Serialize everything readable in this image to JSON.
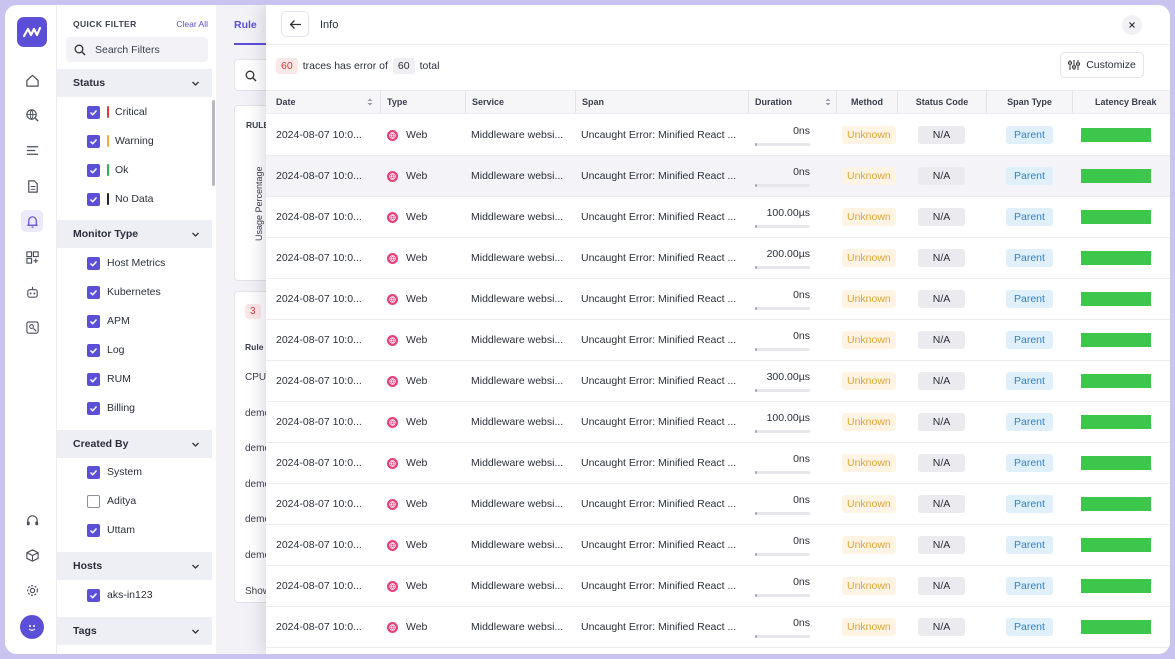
{
  "filter": {
    "title": "QUICK FILTER",
    "clear_label": "Clear All",
    "search_placeholder": "Search Filters",
    "sections": {
      "status": {
        "title": "Status",
        "items": [
          {
            "label": "Critical",
            "checked": true,
            "color": "#e23b3b"
          },
          {
            "label": "Warning",
            "checked": true,
            "color": "#f0a93a"
          },
          {
            "label": "Ok",
            "checked": true,
            "color": "#2fb24c"
          },
          {
            "label": "No Data",
            "checked": true,
            "color": "#1f2430"
          }
        ]
      },
      "monitor_type": {
        "title": "Monitor Type",
        "items": [
          {
            "label": "Host Metrics",
            "checked": true
          },
          {
            "label": "Kubernetes",
            "checked": true
          },
          {
            "label": "APM",
            "checked": true
          },
          {
            "label": "Log",
            "checked": true
          },
          {
            "label": "RUM",
            "checked": true
          },
          {
            "label": "Billing",
            "checked": true
          }
        ]
      },
      "created_by": {
        "title": "Created By",
        "items": [
          {
            "label": "System",
            "checked": true
          },
          {
            "label": "Aditya",
            "checked": false
          },
          {
            "label": "Uttam",
            "checked": true
          }
        ]
      },
      "hosts": {
        "title": "Hosts",
        "items": [
          {
            "label": "aks-in123",
            "checked": true
          }
        ]
      },
      "tags": {
        "title": "Tags"
      }
    }
  },
  "background": {
    "tab": "Rule",
    "card1_label": "RULE",
    "axis_label": "Usage Percentage",
    "count": "3",
    "col": "Rule N",
    "rows": [
      "CPU",
      "demo",
      "demo",
      "demo",
      "demo",
      "demo"
    ],
    "show": "Show"
  },
  "modal": {
    "title": "Info",
    "summary": {
      "errors": "60",
      "middle": "traces has error of",
      "total": "60",
      "suffix": "total"
    },
    "customize_label": "Customize",
    "columns": [
      "Date",
      "Type",
      "Service",
      "Span",
      "Duration",
      "Method",
      "Status Code",
      "Span Type",
      "Latency Break"
    ],
    "rows": [
      {
        "date": "2024-08-07 10:0...",
        "type": "Web",
        "service": "Middleware websi...",
        "span": "Uncaught Error: Minified React ...",
        "duration": "0ns",
        "fill": 0.03,
        "method": "Unknown",
        "status": "N/A",
        "span_type": "Parent"
      },
      {
        "date": "2024-08-07 10:0...",
        "type": "Web",
        "service": "Middleware websi...",
        "span": "Uncaught Error: Minified React ...",
        "duration": "0ns",
        "fill": 0.03,
        "method": "Unknown",
        "status": "N/A",
        "span_type": "Parent"
      },
      {
        "date": "2024-08-07 10:0...",
        "type": "Web",
        "service": "Middleware websi...",
        "span": "Uncaught Error: Minified React ...",
        "duration": "100.00µs",
        "fill": 0.03,
        "method": "Unknown",
        "status": "N/A",
        "span_type": "Parent"
      },
      {
        "date": "2024-08-07 10:0...",
        "type": "Web",
        "service": "Middleware websi...",
        "span": "Uncaught Error: Minified React ...",
        "duration": "200.00µs",
        "fill": 0.03,
        "method": "Unknown",
        "status": "N/A",
        "span_type": "Parent"
      },
      {
        "date": "2024-08-07 10:0...",
        "type": "Web",
        "service": "Middleware websi...",
        "span": "Uncaught Error: Minified React ...",
        "duration": "0ns",
        "fill": 0.03,
        "method": "Unknown",
        "status": "N/A",
        "span_type": "Parent"
      },
      {
        "date": "2024-08-07 10:0...",
        "type": "Web",
        "service": "Middleware websi...",
        "span": "Uncaught Error: Minified React ...",
        "duration": "0ns",
        "fill": 0.03,
        "method": "Unknown",
        "status": "N/A",
        "span_type": "Parent"
      },
      {
        "date": "2024-08-07 10:0...",
        "type": "Web",
        "service": "Middleware websi...",
        "span": "Uncaught Error: Minified React ...",
        "duration": "300.00µs",
        "fill": 0.03,
        "method": "Unknown",
        "status": "N/A",
        "span_type": "Parent"
      },
      {
        "date": "2024-08-07 10:0...",
        "type": "Web",
        "service": "Middleware websi...",
        "span": "Uncaught Error: Minified React ...",
        "duration": "100.00µs",
        "fill": 0.03,
        "method": "Unknown",
        "status": "N/A",
        "span_type": "Parent"
      },
      {
        "date": "2024-08-07 10:0...",
        "type": "Web",
        "service": "Middleware websi...",
        "span": "Uncaught Error: Minified React ...",
        "duration": "0ns",
        "fill": 0.03,
        "method": "Unknown",
        "status": "N/A",
        "span_type": "Parent"
      },
      {
        "date": "2024-08-07 10:0...",
        "type": "Web",
        "service": "Middleware websi...",
        "span": "Uncaught Error: Minified React ...",
        "duration": "0ns",
        "fill": 0.03,
        "method": "Unknown",
        "status": "N/A",
        "span_type": "Parent"
      },
      {
        "date": "2024-08-07 10:0...",
        "type": "Web",
        "service": "Middleware websi...",
        "span": "Uncaught Error: Minified React ...",
        "duration": "0ns",
        "fill": 0.03,
        "method": "Unknown",
        "status": "N/A",
        "span_type": "Parent"
      },
      {
        "date": "2024-08-07 10:0...",
        "type": "Web",
        "service": "Middleware websi...",
        "span": "Uncaught Error: Minified React ...",
        "duration": "0ns",
        "fill": 0.03,
        "method": "Unknown",
        "status": "N/A",
        "span_type": "Parent"
      },
      {
        "date": "2024-08-07 10:0...",
        "type": "Web",
        "service": "Middleware websi...",
        "span": "Uncaught Error: Minified React ...",
        "duration": "0ns",
        "fill": 0.03,
        "method": "Unknown",
        "status": "N/A",
        "span_type": "Parent"
      }
    ]
  },
  "colors": {
    "accent": "#5b4fd8",
    "latency": "#3cc74c",
    "unknown_bg": "#fff4e4",
    "unknown_fg": "#e0a33a",
    "parent_bg": "#dff0fb",
    "parent_fg": "#3a7fbf"
  },
  "icons": [
    "logo-icon",
    "home-icon",
    "globe-search-icon",
    "list-icon",
    "document-icon",
    "alert-bell-icon",
    "dashboard-add-icon",
    "robot-icon",
    "user-search-icon",
    "headset-icon",
    "package-icon",
    "gear-icon"
  ]
}
